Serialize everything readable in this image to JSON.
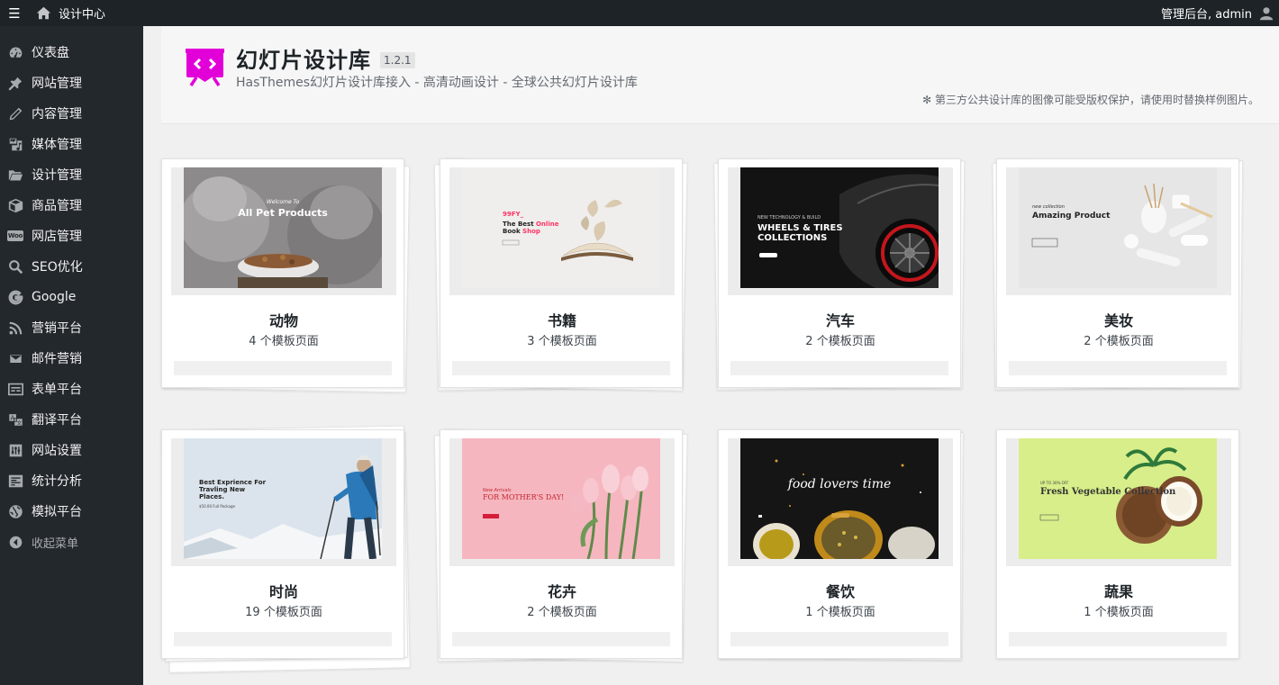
{
  "topbar": {
    "menu_icon": "hamburger-icon",
    "home_icon": "home-icon",
    "site_title": "设计中心",
    "user_text": "管理后台, admin",
    "user_icon": "user-icon"
  },
  "sidebar": {
    "items": [
      {
        "label": "仪表盘",
        "icon": "dashboard-icon"
      },
      {
        "label": "网站管理",
        "icon": "pin-icon"
      },
      {
        "label": "内容管理",
        "icon": "pencil-icon"
      },
      {
        "label": "媒体管理",
        "icon": "media-icon"
      },
      {
        "label": "设计管理",
        "icon": "folder-icon"
      },
      {
        "label": "商品管理",
        "icon": "box-icon"
      },
      {
        "label": "网店管理",
        "icon": "woo-icon"
      },
      {
        "label": "SEO优化",
        "icon": "search-icon"
      },
      {
        "label": "Google",
        "icon": "google-icon"
      },
      {
        "label": "营销平台",
        "icon": "rss-icon"
      },
      {
        "label": "邮件营销",
        "icon": "mail-icon"
      },
      {
        "label": "表单平台",
        "icon": "form-icon"
      },
      {
        "label": "翻译平台",
        "icon": "translate-icon"
      },
      {
        "label": "网站设置",
        "icon": "settings-icon"
      },
      {
        "label": "统计分析",
        "icon": "stats-icon"
      },
      {
        "label": "模拟平台",
        "icon": "globe-icon"
      }
    ],
    "collapse_label": "收起菜单",
    "collapse_icon": "collapse-arrow-icon"
  },
  "header": {
    "logo_icon": "slider-logo-icon",
    "logo_color": "#e200d8",
    "title": "幻灯片设计库",
    "version": "1.2.1",
    "subtitle": "HasThemes幻灯片设计库接入 - 高清动画设计 - 全球公共幻灯片设计库",
    "notice": "✻ 第三方公共设计库的图像可能受版权保护，请使用时替换样例图片。"
  },
  "cards": [
    {
      "category": "动物",
      "count": "4 个模板页面",
      "thumb": {
        "line1": "Welcome To",
        "line2": "All Pet Products"
      }
    },
    {
      "category": "书籍",
      "count": "3 个模板页面",
      "thumb": {
        "line1": "99FY_",
        "line2": "The Best",
        "line2b": "Online",
        "line3": "Book",
        "line3b": "Shop"
      }
    },
    {
      "category": "汽车",
      "count": "2 个模板页面",
      "thumb": {
        "line1": "NEW TECHNOLOGY & BUILD",
        "line2": "WHEELS & TIRES",
        "line3": "COLLECTIONS"
      }
    },
    {
      "category": "美妆",
      "count": "2 个模板页面",
      "thumb": {
        "line1": "new collection",
        "line2": "Amazing Product"
      }
    },
    {
      "category": "时尚",
      "count": "19 个模板页面",
      "thumb": {
        "line1": "Best Exprience For",
        "line2": "Travling New",
        "line3": "Places.",
        "line4": "$50.00 Full Package"
      }
    },
    {
      "category": "花卉",
      "count": "2 个模板页面",
      "thumb": {
        "line1": "New Arrivals",
        "line2": "FOR MOTHER'S DAY!"
      }
    },
    {
      "category": "餐饮",
      "count": "1 个模板页面",
      "thumb": {
        "line1": "food lovers time"
      }
    },
    {
      "category": "蔬果",
      "count": "1 个模板页面",
      "thumb": {
        "line1": "UP TO 30% OFF",
        "line2": "Fresh Vegetable Collection"
      }
    }
  ]
}
